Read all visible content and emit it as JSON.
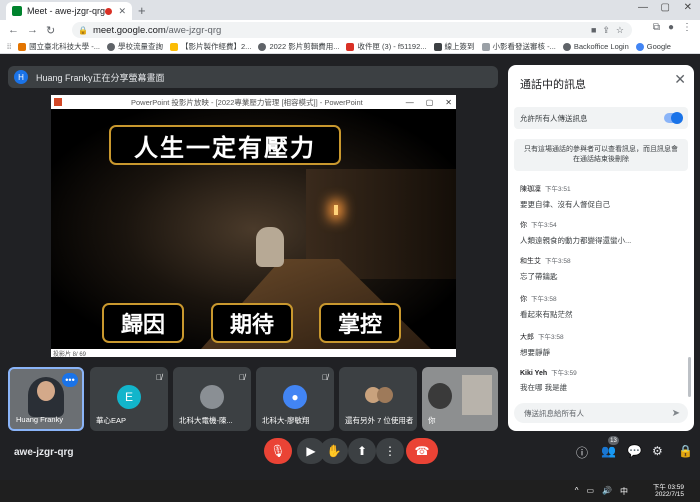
{
  "browser": {
    "tab_title": "Meet - awe-jzgr-qrg",
    "url_host": "meet.google.com",
    "url_path": "/awe-jzgr-qrg",
    "bookmarks": [
      "國立臺北科技大學 -...",
      "學校流量查詢",
      "【影片製作經費】2...",
      "2022 影片剪輯費用...",
      "收件匣 (3) - f51192...",
      "線上簽到",
      "小影看發送審核 -...",
      "Backoffice Login",
      "Google"
    ]
  },
  "meet": {
    "presenting_banner": "Huang Franky正在分享螢幕畫面",
    "presenter_initial": "H",
    "meeting_code": "awe-jzgr-qrg"
  },
  "presentation": {
    "window_title": "PowerPoint 投影片放映 - [2022專業壓力管理 [相容模式]] - PowerPoint",
    "title_text": "人生一定有壓力",
    "box_left": "歸因",
    "box_middle": "期待",
    "box_right": "掌控",
    "status": "投影片 8/ 69"
  },
  "chat": {
    "title": "通話中的訊息",
    "allow_label": "允許所有人傳送訊息",
    "notice": "只有這場通話的參與者可以查看訊息，而且訊息會在通話結束後刪除",
    "input_placeholder": "傳送訊息給所有人",
    "messages": [
      {
        "sender": "陳珈凜",
        "time": "下午3:51",
        "text": "要更自律、沒有人督促自己"
      },
      {
        "sender": "你",
        "time": "下午3:54",
        "text": "人類遠親食的動力都變得還蠻小..."
      },
      {
        "sender": "和生艾",
        "time": "下午3:58",
        "text": "忘了帶鑰匙"
      },
      {
        "sender": "你",
        "time": "下午3:58",
        "text": "看起來有點茫然"
      },
      {
        "sender": "大郎",
        "time": "下午3:58",
        "text": "想要靜靜"
      },
      {
        "sender": "Kiki Yeh",
        "time": "下午3:59",
        "text": "我在哪 我是誰"
      }
    ]
  },
  "participants": [
    {
      "name": "Huang Franky",
      "initial": ""
    },
    {
      "name": "華心EAP",
      "initial": "E"
    },
    {
      "name": "北科大電機-陳...",
      "initial": ""
    },
    {
      "name": "北科大-廖敏翔",
      "initial": ""
    },
    {
      "name": "還有另外 7 位使用者",
      "initial": ""
    },
    {
      "name": "你",
      "initial": ""
    }
  ],
  "people_count": "13",
  "taskbar": {
    "time": "下午 03:59",
    "date": "2022/7/15"
  },
  "colors": {
    "accent": "#1a73e8",
    "danger": "#ea4335",
    "slide_border": "#c9982e"
  }
}
